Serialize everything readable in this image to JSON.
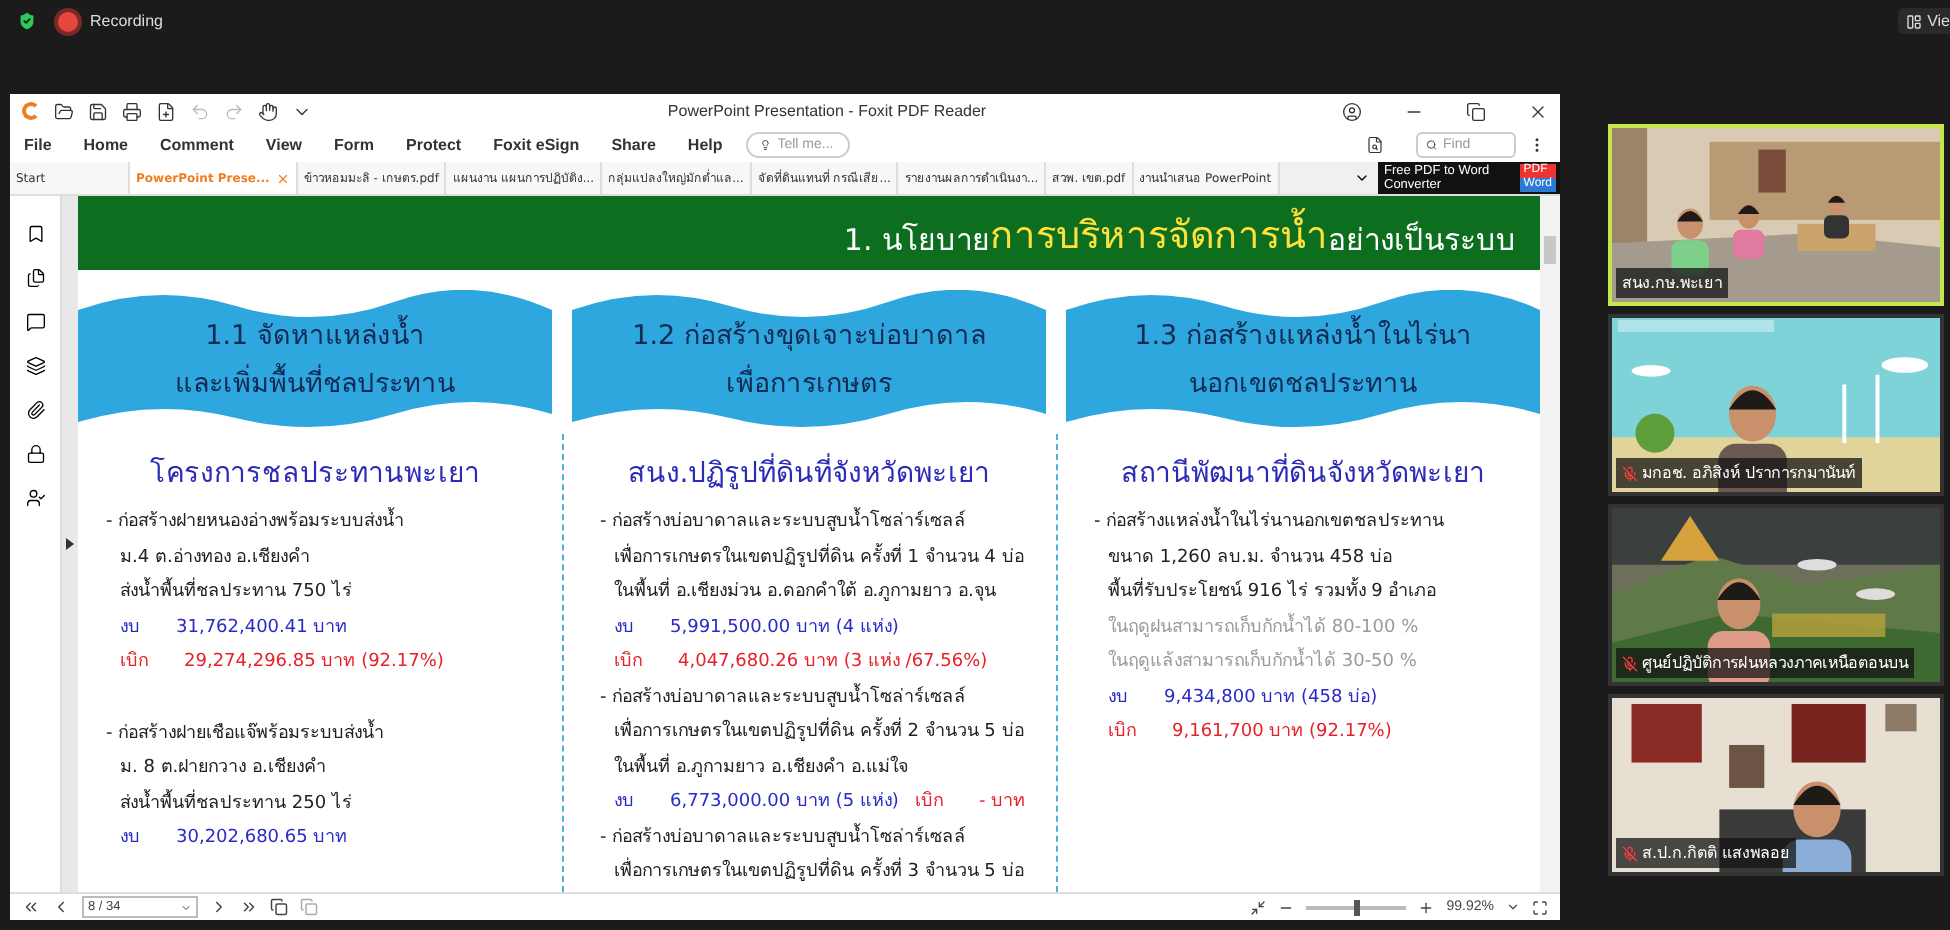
{
  "meeting_bar": {
    "recording": "Recording",
    "view_button": "Vie"
  },
  "reader": {
    "title": "PowerPoint Presentation - Foxit PDF Reader",
    "menu": [
      "File",
      "Home",
      "Comment",
      "View",
      "Form",
      "Protect",
      "Foxit eSign",
      "Share",
      "Help"
    ],
    "tell_me": {
      "placeholder": "Tell me..."
    },
    "find": {
      "placeholder": "Find"
    },
    "ad": {
      "text": "Free PDF to Word Converter",
      "badge_top": "PDF",
      "badge_bottom": "Word"
    },
    "tabs": [
      {
        "label": "Start",
        "selected": false
      },
      {
        "label": "PowerPoint Prese...",
        "selected": true
      },
      {
        "label": "ข้าวหอมมะลิ - เกษตร.pdf",
        "selected": false
      },
      {
        "label": "แผนงาน แผนการปฏิบัติง...",
        "selected": false
      },
      {
        "label": "กลุ่มแปลงใหญ่มักต่ำแล...",
        "selected": false
      },
      {
        "label": "จัดที่ดินแทนที่ กรณีเสีย...",
        "selected": false
      },
      {
        "label": "รายงานผลการดำเนินงา...",
        "selected": false
      },
      {
        "label": "สวพ. เขต.pdf",
        "selected": false
      },
      {
        "label": "งานนำเสนอ PowerPoint",
        "selected": false
      }
    ],
    "status_bar": {
      "page": "8 / 34",
      "zoom": "99.92%",
      "zoom_slider": {
        "level": 0.5
      }
    }
  },
  "slide": {
    "heading": {
      "prefix": "1. นโยบาย",
      "highlight": "การบริหารจัดการน้ำ",
      "suffix": "อย่างเป็นระบบ"
    },
    "columns": [
      {
        "title": [
          "1.1 จัดหาแหล่งน้ำ",
          "และเพิ่มพื้นที่ชลประทาน"
        ],
        "agency": "โครงการชลประทานพะเยา",
        "entries": [
          {
            "lines": [
              {
                "kind": "text",
                "text": "- ก่อสร้างฝายหนองอ่างพร้อมระบบส่งน้ำ"
              },
              {
                "kind": "text",
                "text": "ม.4 ต.อ่างทอง อ.เชียงคำ"
              },
              {
                "kind": "text",
                "text": "ส่งน้ำพื้นที่ชลประทาน 750 ไร่"
              }
            ],
            "figures": [
              [
                {
                  "kind": "budget",
                  "label": "งบ",
                  "value": "31,762,400.41 บาท"
                }
              ],
              [
                {
                  "kind": "withdraw",
                  "label": "เบิก",
                  "value": "29,274,296.85 บาท (92.17%)"
                }
              ]
            ]
          },
          {
            "lines": [
              {
                "kind": "text",
                "text": "- ก่อสร้างฝายเชือแจ๊พร้อมระบบส่งน้ำ"
              },
              {
                "kind": "text",
                "text": "ม. 8 ต.ฝายกวาง อ.เชียงคำ"
              },
              {
                "kind": "text",
                "text": "ส่งน้ำพื้นที่ชลประทาน 250 ไร่"
              }
            ],
            "figures": [
              [
                {
                  "kind": "budget",
                  "label": "งบ",
                  "value": "30,202,680.65 บาท"
                }
              ]
            ]
          }
        ]
      },
      {
        "title": [
          "1.2 ก่อสร้างขุดเจาะบ่อบาดาล",
          "เพื่อการเกษตร"
        ],
        "agency": "สนง.ปฏิรูปที่ดินที่จังหวัดพะเยา",
        "entries": [
          {
            "lines": [
              {
                "kind": "text",
                "text": "- ก่อสร้างบ่อบาดาลและระบบสูบน้ำโซล่าร์เซลล์"
              },
              {
                "kind": "text",
                "text": "เพื่อการเกษตรในเขตปฏิรูปที่ดิน ครั้งที่ 1 จำนวน 4 บ่อ"
              },
              {
                "kind": "text",
                "text": "ในพื้นที่ อ.เชียงม่วน อ.ดอกคำใต้ อ.ภูกามยาว อ.จุน"
              }
            ],
            "figures": [
              [
                {
                  "kind": "budget",
                  "label": "งบ",
                  "value": "5,991,500.00 บาท (4 แห่ง)"
                }
              ],
              [
                {
                  "kind": "withdraw",
                  "label": "เบิก",
                  "value": "4,047,680.26 บาท (3 แห่ง /67.56%)"
                }
              ]
            ]
          },
          {
            "lines": [
              {
                "kind": "text",
                "text": "- ก่อสร้างบ่อบาดาลและระบบสูบน้ำโซล่าร์เซลล์"
              },
              {
                "kind": "text",
                "text": "เพื่อการเกษตรในเขตปฏิรูปที่ดิน ครั้งที่ 2  จำนวน 5 บ่อ"
              },
              {
                "kind": "text",
                "text": "ในพื้นที่ อ.ภูกามยาว อ.เชียงคำ อ.แม่ใจ"
              }
            ],
            "figures": [
              [
                {
                  "kind": "budget",
                  "label": "งบ",
                  "value": "6,773,000.00 บาท (5 แห่ง)"
                },
                {
                  "kind": "withdraw",
                  "label": "เบิก",
                  "value": "-  บาท"
                }
              ]
            ]
          },
          {
            "lines": [
              {
                "kind": "text",
                "text": "- ก่อสร้างบ่อบาดาลและระบบสูบน้ำโซล่าร์เซลล์"
              },
              {
                "kind": "text",
                "text": "เพื่อการเกษตรในเขตปฏิรูปที่ดิน ครั้งที่ 3  จำนวน 5 บ่อ"
              }
            ]
          }
        ]
      },
      {
        "title": [
          "1.3 ก่อสร้างแหล่งน้ำในไร่นา",
          "นอกเขตชลประทาน"
        ],
        "agency": "สถานีพัฒนาที่ดินจังหวัดพะเยา",
        "entries": [
          {
            "lines": [
              {
                "kind": "text",
                "text": "- ก่อสร้างแหล่งน้ำในไร่นานอกเขตชลประทาน"
              },
              {
                "kind": "text",
                "text": "ขนาด 1,260 ลบ.ม.  จำนวน 458 บ่อ"
              },
              {
                "kind": "text",
                "text": "พื้นที่รับประโยชน์  916 ไร่ รวมทั้ง 9 อำเภอ"
              },
              {
                "kind": "note",
                "text": "ในฤดูฝนสามารถเก็บกักน้ำได้ 80-100 %"
              },
              {
                "kind": "note",
                "text": "ในฤดูแล้งสามารถเก็บกักน้ำได้ 30-50 %"
              }
            ],
            "figures": [
              [
                {
                  "kind": "budget",
                  "label": "งบ",
                  "value": "9,434,800 บาท (458 บ่อ)"
                }
              ],
              [
                {
                  "kind": "withdraw",
                  "label": "เบิก",
                  "value": "9,161,700 บาท (92.17%)"
                }
              ]
            ]
          }
        ]
      }
    ]
  },
  "participants": [
    {
      "name": "สนง.กษ.พะเยา",
      "speaking": true,
      "muted": false,
      "kind": "room"
    },
    {
      "name": "มกอช. อภิสิงห์ ปราการกมานันท์",
      "speaking": false,
      "muted": true,
      "kind": "sky"
    },
    {
      "name": "ศูนย์ปฏิบัติการฝนหลวงภาคเหนือตอนบน",
      "speaking": false,
      "muted": true,
      "kind": "landscape"
    },
    {
      "name": "ส.ป.ก.กิตติ แสงพลอย",
      "speaking": false,
      "muted": true,
      "kind": "office"
    }
  ]
}
